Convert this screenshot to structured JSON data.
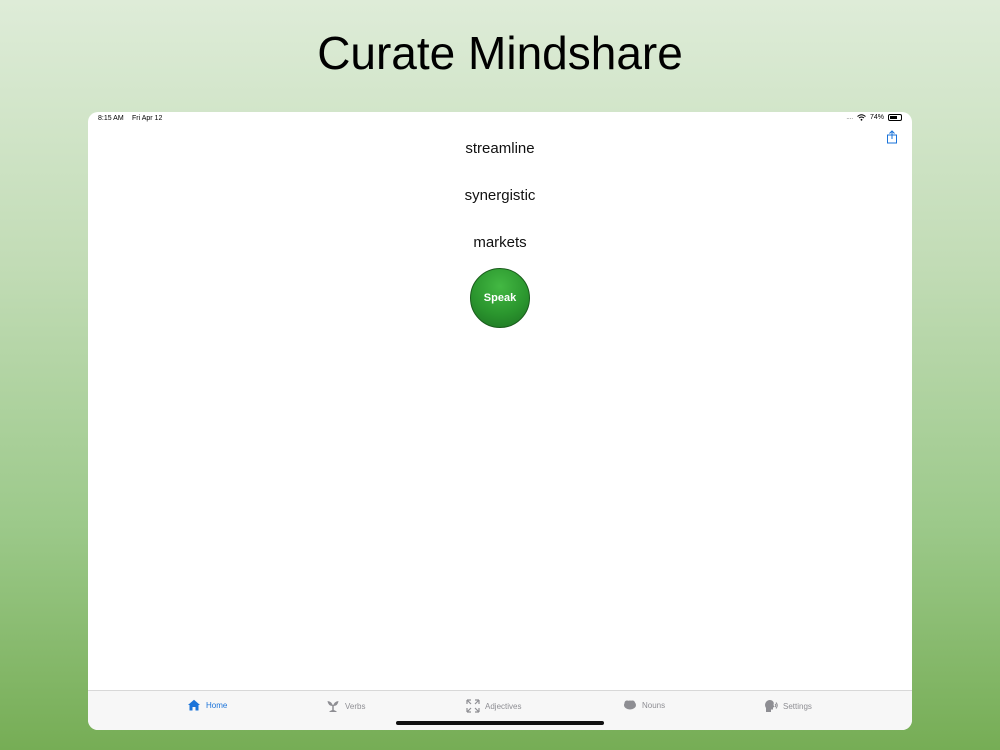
{
  "headline": "Curate Mindshare",
  "status_bar": {
    "time": "8:15 AM",
    "date": "Fri Apr 12",
    "signal": "....",
    "battery": "74%",
    "battery_level": 0.74
  },
  "words": [
    "streamline",
    "synergistic",
    "markets"
  ],
  "speak_label": "Speak",
  "tabs": [
    {
      "label": "Home",
      "icon": "home-icon",
      "active": true
    },
    {
      "label": "Verbs",
      "icon": "sprout-icon",
      "active": false
    },
    {
      "label": "Adjectives",
      "icon": "expand-icon",
      "active": false
    },
    {
      "label": "Nouns",
      "icon": "cloud-icon",
      "active": false
    },
    {
      "label": "Settings",
      "icon": "speaking-head-icon",
      "active": false
    }
  ],
  "colors": {
    "accent": "#1a73d9",
    "speak_green": "#2b962e",
    "inactive": "#8e8e93"
  }
}
